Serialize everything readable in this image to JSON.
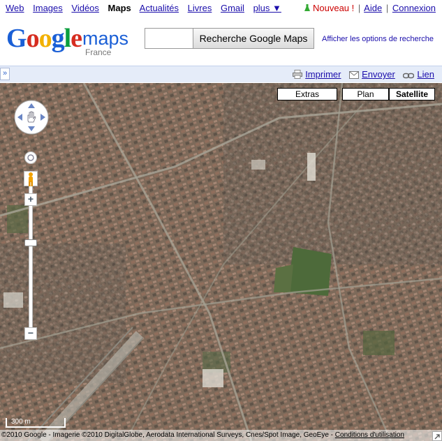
{
  "topnav": {
    "links": [
      "Web",
      "Images",
      "Vidéos"
    ],
    "active": "Maps",
    "links_after": [
      "Actualités",
      "Livres",
      "Gmail"
    ],
    "more": "plus ▼",
    "new_label": "Nouveau !",
    "help": "Aide",
    "signin": "Connexion"
  },
  "logo": {
    "letters": [
      "G",
      "o",
      "o",
      "g",
      "l",
      "e"
    ],
    "maps": "maps",
    "country": "France"
  },
  "search": {
    "value": "",
    "button": "Recherche Google Maps",
    "options_link": "Afficher les options de recherche"
  },
  "toolbar": {
    "collapse": "»",
    "print": "Imprimer",
    "send": "Envoyer",
    "link": "Lien"
  },
  "maptypes": {
    "extras": "Extras",
    "plan": "Plan",
    "satellite": "Satellite",
    "active": "Satellite"
  },
  "map": {
    "scale": "300 m",
    "attribution_prefix": "©2010 Google - Imagerie ©2010 DigitalGlobe, Aerodata International Surveys, Cnes/Spot Image, GeoEye -",
    "terms": "Conditions d'utilisation"
  },
  "colors": {
    "link": "#1a0dab",
    "toolbar_bg": "#e5ecf9",
    "new_label": "#cc0000"
  }
}
